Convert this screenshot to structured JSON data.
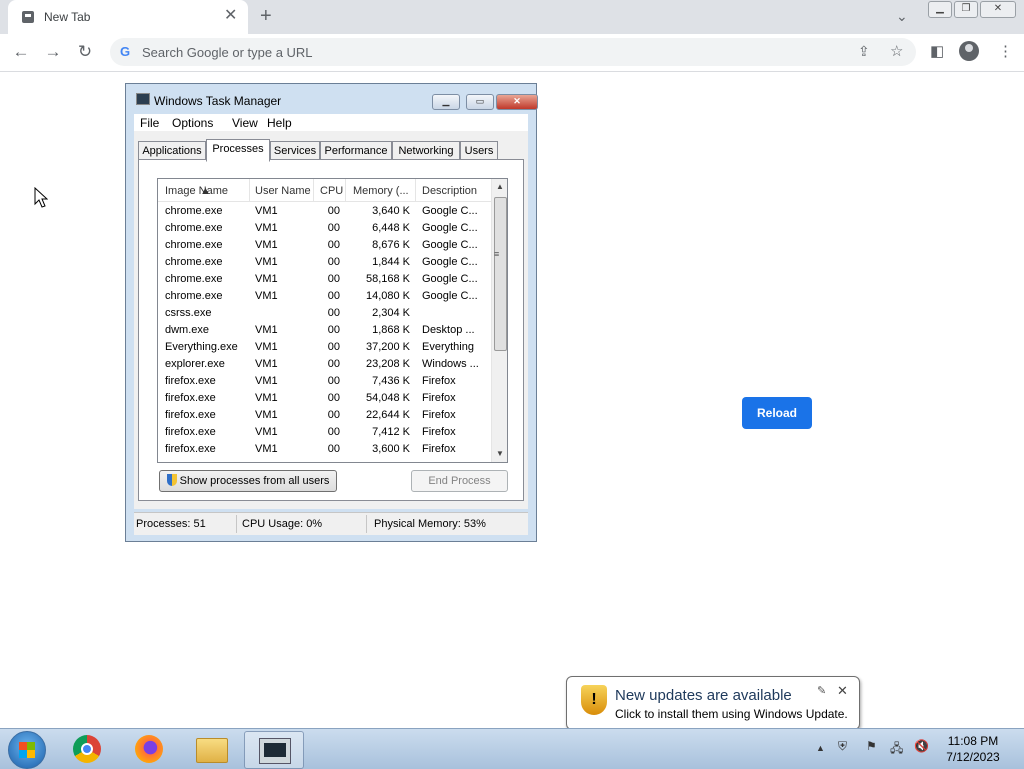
{
  "browser": {
    "tab_title": "New Tab",
    "omnibox_placeholder": "Search Google or type a URL",
    "reload_label": "Reload"
  },
  "task_manager": {
    "title": "Windows Task Manager",
    "menu": [
      "File",
      "Options",
      "View",
      "Help"
    ],
    "tabs": [
      "Applications",
      "Processes",
      "Services",
      "Performance",
      "Networking",
      "Users"
    ],
    "active_tab": "Processes",
    "columns": [
      "Image Name",
      "User Name",
      "CPU",
      "Memory (...",
      "Description"
    ],
    "rows": [
      {
        "name": "chrome.exe",
        "user": "VM1",
        "cpu": "00",
        "mem": "3,640 K",
        "desc": "Google C..."
      },
      {
        "name": "chrome.exe",
        "user": "VM1",
        "cpu": "00",
        "mem": "6,448 K",
        "desc": "Google C..."
      },
      {
        "name": "chrome.exe",
        "user": "VM1",
        "cpu": "00",
        "mem": "8,676 K",
        "desc": "Google C..."
      },
      {
        "name": "chrome.exe",
        "user": "VM1",
        "cpu": "00",
        "mem": "1,844 K",
        "desc": "Google C..."
      },
      {
        "name": "chrome.exe",
        "user": "VM1",
        "cpu": "00",
        "mem": "58,168 K",
        "desc": "Google C..."
      },
      {
        "name": "chrome.exe",
        "user": "VM1",
        "cpu": "00",
        "mem": "14,080 K",
        "desc": "Google C..."
      },
      {
        "name": "csrss.exe",
        "user": "",
        "cpu": "00",
        "mem": "2,304 K",
        "desc": ""
      },
      {
        "name": "dwm.exe",
        "user": "VM1",
        "cpu": "00",
        "mem": "1,868 K",
        "desc": "Desktop ..."
      },
      {
        "name": "Everything.exe",
        "user": "VM1",
        "cpu": "00",
        "mem": "37,200 K",
        "desc": "Everything"
      },
      {
        "name": "explorer.exe",
        "user": "VM1",
        "cpu": "00",
        "mem": "23,208 K",
        "desc": "Windows ..."
      },
      {
        "name": "firefox.exe",
        "user": "VM1",
        "cpu": "00",
        "mem": "7,436 K",
        "desc": "Firefox"
      },
      {
        "name": "firefox.exe",
        "user": "VM1",
        "cpu": "00",
        "mem": "54,048 K",
        "desc": "Firefox"
      },
      {
        "name": "firefox.exe",
        "user": "VM1",
        "cpu": "00",
        "mem": "22,644 K",
        "desc": "Firefox"
      },
      {
        "name": "firefox.exe",
        "user": "VM1",
        "cpu": "00",
        "mem": "7,412 K",
        "desc": "Firefox"
      },
      {
        "name": "firefox.exe",
        "user": "VM1",
        "cpu": "00",
        "mem": "3,600 K",
        "desc": "Firefox"
      }
    ],
    "show_all_button": "Show processes from all users",
    "end_process_button": "End Process",
    "status": {
      "processes": "Processes: 51",
      "cpu": "CPU Usage: 0%",
      "memory": "Physical Memory: 53%"
    }
  },
  "notification": {
    "heading": "New updates are available",
    "body": "Click to install them using Windows Update."
  },
  "taskbar": {
    "apps": [
      "chrome-icon",
      "firefox-icon",
      "file-explorer-icon",
      "task-manager-icon"
    ],
    "time": "11:08 PM",
    "date": "7/12/2023"
  }
}
